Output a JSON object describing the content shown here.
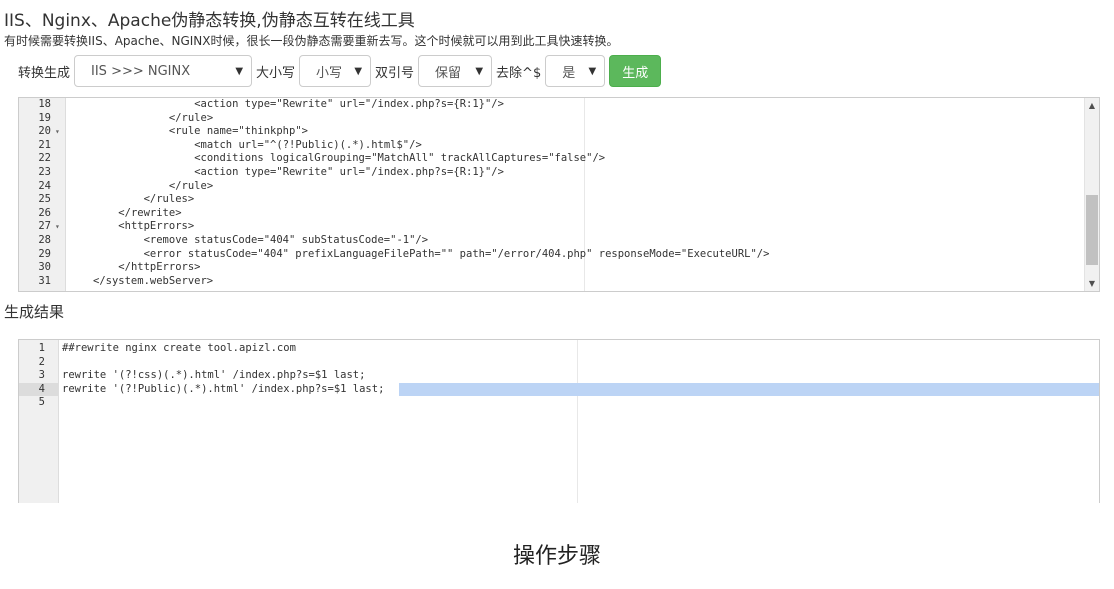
{
  "header": {
    "title": "IIS、Nginx、Apache伪静态转换,伪静态互转在线工具",
    "subtitle": "有时候需要转换IIS、Apache、NGINX时候，很长一段伪静态需要重新去写。这个时候就可以用到此工具快速转换。"
  },
  "controls": {
    "convert_label": "转换生成",
    "convert_value": "IIS >>> NGINX",
    "case_label": "大小写",
    "case_value": "小写",
    "quote_label": "双引号",
    "quote_value": "保留",
    "strip_label": "去除^$",
    "strip_value": "是",
    "generate_label": "生成"
  },
  "input_editor": {
    "lines": [
      {
        "n": "18",
        "fold": "",
        "indent": 5,
        "text": "<action type=\"Rewrite\" url=\"/index.php?s={R:1}\"/>"
      },
      {
        "n": "19",
        "fold": "",
        "indent": 4,
        "text": "</rule>"
      },
      {
        "n": "20",
        "fold": "▾",
        "indent": 4,
        "text": "<rule name=\"thinkphp\">"
      },
      {
        "n": "21",
        "fold": "",
        "indent": 5,
        "text": "<match url=\"^(?!Public)(.*).html$\"/>"
      },
      {
        "n": "22",
        "fold": "",
        "indent": 5,
        "text": "<conditions logicalGrouping=\"MatchAll\" trackAllCaptures=\"false\"/>"
      },
      {
        "n": "23",
        "fold": "",
        "indent": 5,
        "text": "<action type=\"Rewrite\" url=\"/index.php?s={R:1}\"/>"
      },
      {
        "n": "24",
        "fold": "",
        "indent": 4,
        "text": "</rule>"
      },
      {
        "n": "25",
        "fold": "",
        "indent": 3,
        "text": "</rules>"
      },
      {
        "n": "26",
        "fold": "",
        "indent": 2,
        "text": "</rewrite>"
      },
      {
        "n": "27",
        "fold": "▾",
        "indent": 2,
        "text": "<httpErrors>"
      },
      {
        "n": "28",
        "fold": "",
        "indent": 3,
        "text": "<remove statusCode=\"404\" subStatusCode=\"-1\"/>"
      },
      {
        "n": "29",
        "fold": "",
        "indent": 3,
        "text": "<error statusCode=\"404\" prefixLanguageFilePath=\"\" path=\"/error/404.php\" responseMode=\"ExecuteURL\"/>"
      },
      {
        "n": "30",
        "fold": "",
        "indent": 2,
        "text": "</httpErrors>"
      },
      {
        "n": "31",
        "fold": "",
        "indent": 1,
        "text": "</system.webServer>"
      }
    ],
    "scroll_up_icon": "triangle-up",
    "scroll_down_icon": "triangle-down"
  },
  "result_label": "生成结果",
  "output_editor": {
    "lines": [
      {
        "n": "1",
        "text": "##rewrite nginx create tool.apizl.com"
      },
      {
        "n": "2",
        "text": ""
      },
      {
        "n": "3",
        "text": "rewrite '(?!css)(.*).html' /index.php?s=$1 last;"
      },
      {
        "n": "4",
        "text": "rewrite '(?!Public)(.*).html' /index.php?s=$1 last;"
      },
      {
        "n": "5",
        "text": ""
      }
    ],
    "active_line": "4"
  },
  "steps_caption": "操作步骤",
  "colors": {
    "generate_button": "#5cb85c",
    "selection": "#bcd4f5"
  }
}
